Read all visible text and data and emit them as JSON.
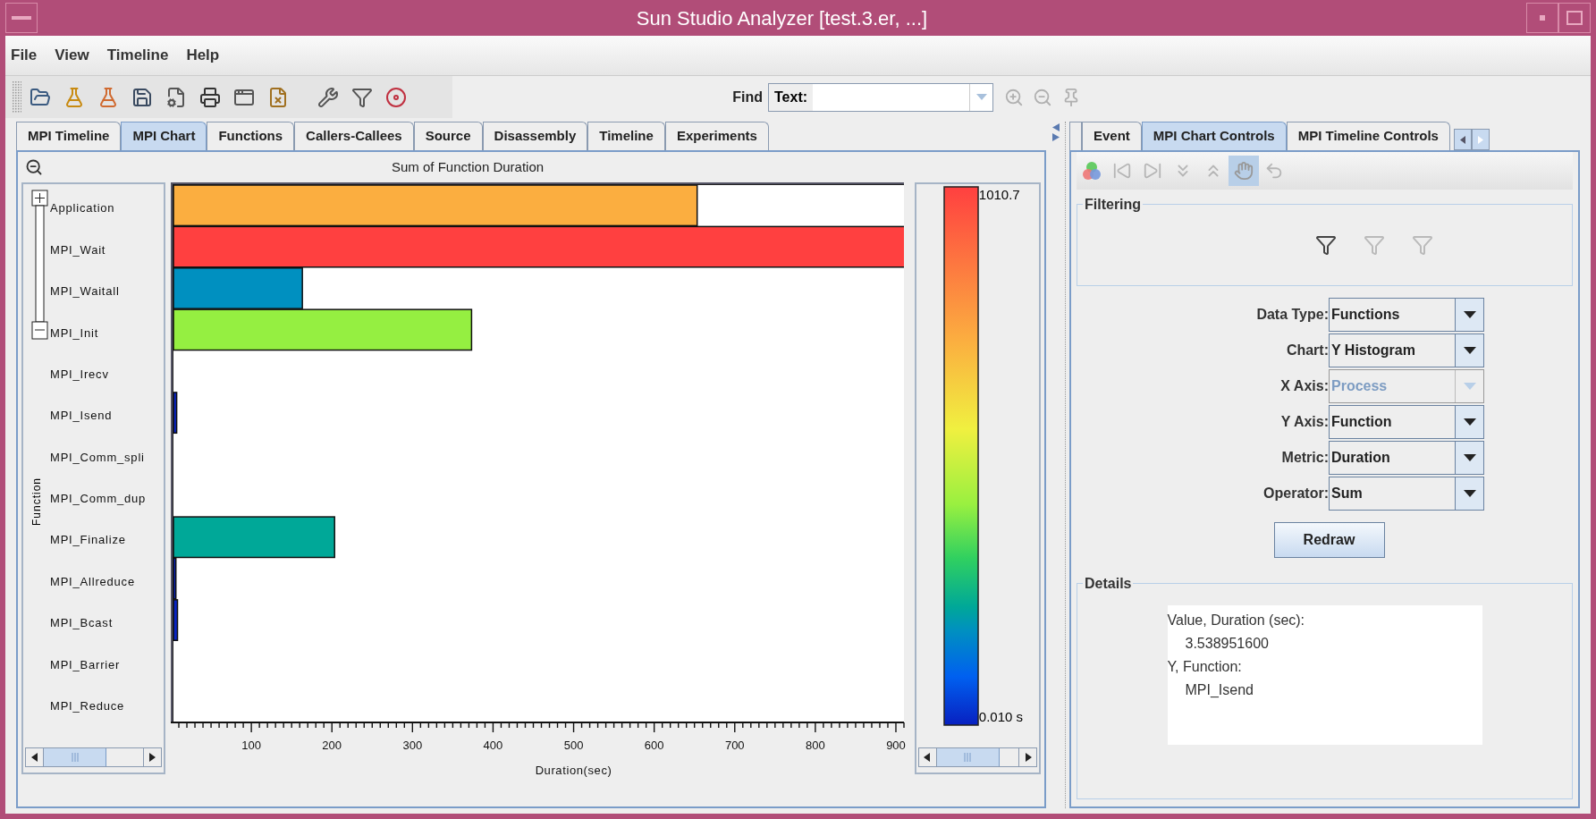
{
  "window": {
    "title": "Sun Studio Analyzer [test.3.er, ...]"
  },
  "menu": [
    "File",
    "View",
    "Timeline",
    "Help"
  ],
  "find": {
    "label": "Find",
    "field_label": "Text:"
  },
  "main_tabs": [
    {
      "label": "MPI Timeline",
      "selected": false
    },
    {
      "label": "MPI Chart",
      "selected": true
    },
    {
      "label": "Functions",
      "selected": false
    },
    {
      "label": "Callers-Callees",
      "selected": false
    },
    {
      "label": "Source",
      "selected": false
    },
    {
      "label": "Disassembly",
      "selected": false
    },
    {
      "label": "Timeline",
      "selected": false
    },
    {
      "label": "Experiments",
      "selected": false
    }
  ],
  "chart_panel": {
    "chart_data": {
      "type": "bar",
      "orientation": "horizontal",
      "title": "Sum of Function Duration",
      "xlabel": "Duration(sec)",
      "ylabel": "Function",
      "categories": [
        "Application",
        "MPI_Wait",
        "MPI_Waitall",
        "MPI_Init",
        "MPI_Irecv",
        "MPI_Isend",
        "MPI_Comm_spli",
        "MPI_Comm_dup",
        "MPI_Finalize",
        "MPI_Allreduce",
        "MPI_Bcast",
        "MPI_Barrier",
        "MPI_Reduce"
      ],
      "series": [
        {
          "values": [
            650,
            910,
            160,
            370,
            0,
            4,
            0,
            0,
            200,
            3,
            5,
            0,
            0
          ]
        }
      ],
      "xlim": [
        0,
        910
      ],
      "xticks": [
        100,
        200,
        300,
        400,
        500,
        600,
        700,
        800,
        900
      ]
    },
    "color_scale": {
      "max_label": "1010.7",
      "min_label": "0.010 s"
    }
  },
  "control_tabs": [
    {
      "label": "Event",
      "selected": false
    },
    {
      "label": "MPI Chart Controls",
      "selected": true
    },
    {
      "label": "MPI Timeline Controls",
      "selected": false
    }
  ],
  "filtering": {
    "title": "Filtering"
  },
  "controls": [
    {
      "label": "Data Type:",
      "value": "Functions",
      "disabled": false
    },
    {
      "label": "Chart:",
      "value": "Y Histogram",
      "disabled": false
    },
    {
      "label": "X Axis:",
      "value": "Process",
      "disabled": true
    },
    {
      "label": "Y Axis:",
      "value": "Function",
      "disabled": false
    },
    {
      "label": "Metric:",
      "value": "Duration",
      "disabled": false
    },
    {
      "label": "Operator:",
      "value": "Sum",
      "disabled": false
    }
  ],
  "redraw_button": "Redraw",
  "details": {
    "title": "Details",
    "lines": [
      {
        "text": "Value, Duration (sec):",
        "kind": "heading"
      },
      {
        "text": "3.538951600",
        "kind": "value"
      },
      {
        "text": "Y, Function:",
        "kind": "heading"
      },
      {
        "text": "MPI_Isend",
        "kind": "value"
      }
    ]
  }
}
